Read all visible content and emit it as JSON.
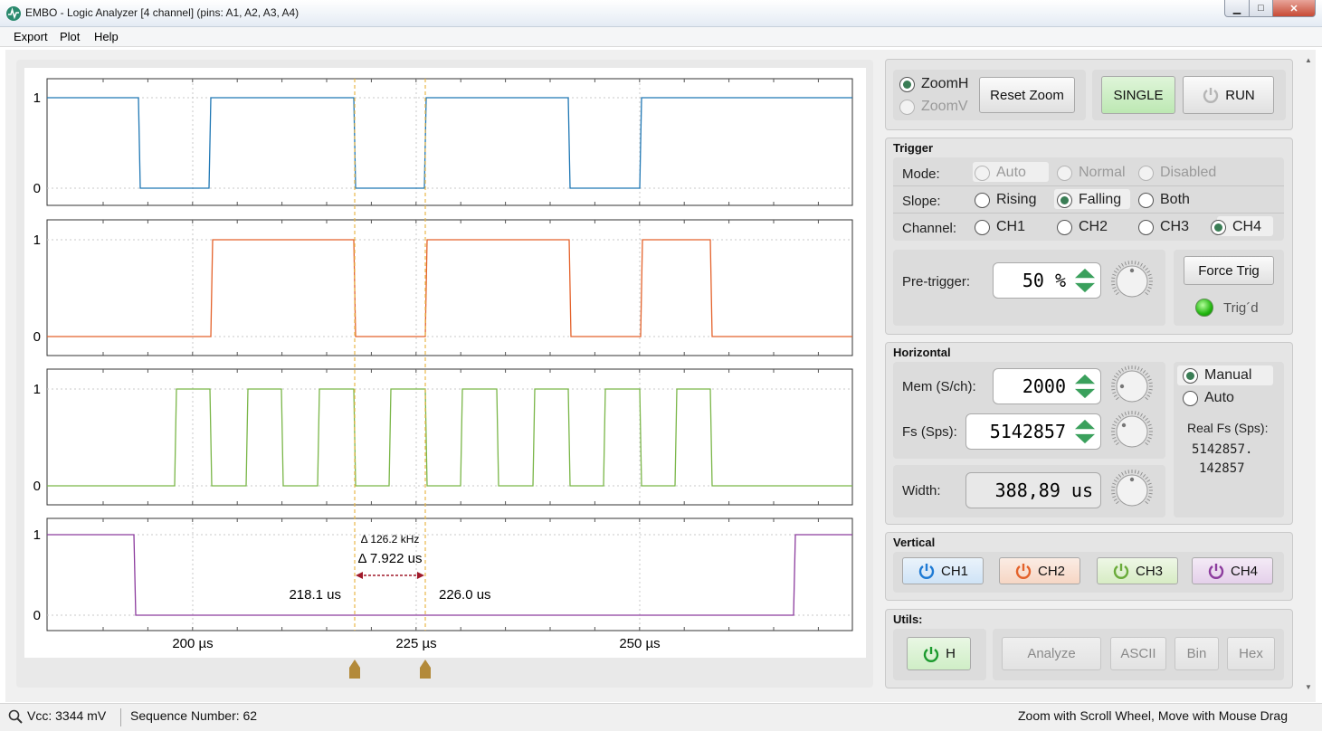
{
  "window": {
    "title": "EMBO - Logic Analyzer [4 channel] (pins: A1, A2, A3, A4)"
  },
  "menu": [
    "Export",
    "Plot",
    "Help"
  ],
  "plot": {
    "cursor1_label": "218.1 us",
    "cursor2_label": "226.0 us",
    "delta_freq": "Δ 126.2 kHz",
    "delta_time": "Δ 7.922 us",
    "x_ticks": [
      "200 µs",
      "225 µs",
      "250 µs"
    ],
    "y_high": "1",
    "y_low": "0",
    "colors": {
      "ch1": "#1f77b4",
      "ch2": "#e4622b",
      "ch3": "#7ab648",
      "ch4": "#8c3c9e",
      "cursor": "#e8b84a",
      "delta": "#a01a2a"
    }
  },
  "zoom": {
    "zoomh": "ZoomH",
    "zoomv": "ZoomV",
    "reset": "Reset Zoom",
    "single": "SINGLE",
    "run": "RUN"
  },
  "trigger": {
    "title": "Trigger",
    "mode_label": "Mode:",
    "modes": [
      "Auto",
      "Normal",
      "Disabled"
    ],
    "slope_label": "Slope:",
    "slopes": [
      "Rising",
      "Falling",
      "Both"
    ],
    "channel_label": "Channel:",
    "channels": [
      "CH1",
      "CH2",
      "CH3",
      "CH4"
    ],
    "pretrigger_label": "Pre-trigger:",
    "pretrigger_value": "50 %",
    "force": "Force Trig",
    "trigd": "Trig´d"
  },
  "horizontal": {
    "title": "Horizontal",
    "mem_label": "Mem (S/ch):",
    "mem_value": "2000",
    "fs_label": "Fs (Sps):",
    "fs_value": "5142857",
    "width_label": "Width:",
    "width_value": "388,89 us",
    "manual": "Manual",
    "auto": "Auto",
    "realfs_label": "Real Fs (Sps):",
    "realfs_line1": "5142857.",
    "realfs_line2": "142857"
  },
  "vertical": {
    "title": "Vertical",
    "channels": [
      "CH1",
      "CH2",
      "CH3",
      "CH4"
    ]
  },
  "utils": {
    "title": "Utils:",
    "h": "H",
    "analyze": "Analyze",
    "ascii": "ASCII",
    "bin": "Bin",
    "hex": "Hex"
  },
  "status": {
    "vcc": "Vcc: 3344 mV",
    "sequence": "Sequence Number: 62",
    "hint": "Zoom with Scroll Wheel, Move with Mouse Drag"
  }
}
